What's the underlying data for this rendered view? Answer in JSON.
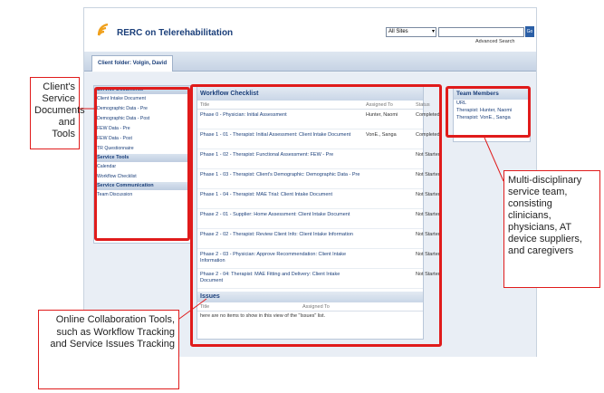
{
  "app": {
    "title": "RERC on Telerehabilitation",
    "site_select": "All Sites",
    "search_button": "Go",
    "advanced_search": "Advanced Search"
  },
  "tab": {
    "label": "Client folder: Volgin, David"
  },
  "leftnav": {
    "sections": [
      {
        "heading": "Service Documents",
        "items": [
          "Client Intake Document",
          "Demographic Data - Pre",
          "Demographic Data - Post",
          "FEW Data - Pre",
          "FEW Data - Post",
          "TR Questionnaire"
        ]
      },
      {
        "heading": "Service Tools",
        "items": [
          "Calendar",
          "Workflow Checklist"
        ]
      },
      {
        "heading": "Service Communication",
        "items": [
          "Team Discussion"
        ]
      }
    ]
  },
  "workflow": {
    "title": "Workflow Checklist",
    "columns": [
      "Title",
      "Assigned To",
      "Status"
    ],
    "rows": [
      {
        "title": "Phase 0 - Physician: Initial Assessment",
        "assigned": "Hunter, Naomi",
        "status": "Completed"
      },
      {
        "title": "Phase 1 - 01 - Therapist: Initial Assessment: Client Intake Document",
        "assigned": "VonE., Sanga",
        "status": "Completed"
      },
      {
        "title": "Phase 1 - 02 - Therapist: Functional Assessment: FEW - Pre",
        "assigned": "",
        "status": "Not Started"
      },
      {
        "title": "Phase 1 - 03 - Therapist: Client's Demographic: Demographic Data - Pre",
        "assigned": "",
        "status": "Not Started"
      },
      {
        "title": "Phase 1 - 04 - Therapist: MAE Trial: Client Intake Document",
        "assigned": "",
        "status": "Not Started"
      },
      {
        "title": "Phase 2 - 01 - Supplier: Home Assessment: Client Intake Document",
        "assigned": "",
        "status": "Not Started"
      },
      {
        "title": "Phase 2 - 02 - Therapist: Review Client Info: Client Intake Information",
        "assigned": "",
        "status": "Not Started"
      },
      {
        "title": "Phase 2 - 03 - Physician: Approve Recommendation: Client Intake Information",
        "assigned": "",
        "status": "Not Started"
      },
      {
        "title": "Phase 2 - 04: Therapist: MAE Fitting and Delivery: Client Intake Document",
        "assigned": "",
        "status": "Not Started"
      }
    ]
  },
  "issues": {
    "title": "Issues",
    "columns": [
      "Title",
      "Assigned To"
    ],
    "empty_message": "here are no items to show in this view of the \"Issues\" list."
  },
  "team": {
    "title": "Team Members",
    "lines": [
      "URL",
      "Therapist: Hunter, Naomi",
      "Therapist: VonE., Sanga"
    ]
  },
  "callouts": {
    "left": "Client's Service Documents and Tools",
    "right": "Multi-disciplinary service team, consisting clinicians, physicians, AT device suppliers, and caregivers",
    "bottom": "Online Collaboration Tools, such as Workflow Tracking and Service Issues Tracking"
  },
  "colors": {
    "annotation_red": "#e01b1b",
    "nav_blue": "#1b3f7a"
  }
}
